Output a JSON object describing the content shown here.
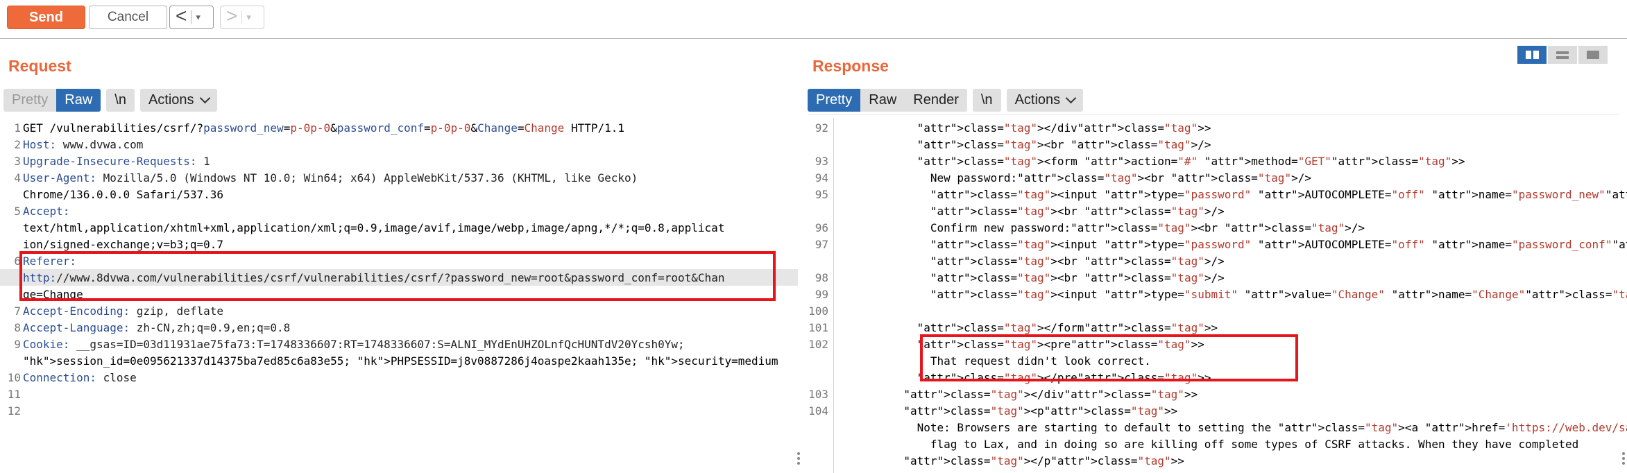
{
  "toolbar": {
    "send_label": "Send",
    "cancel_label": "Cancel",
    "back_arrow": "<",
    "forward_arrow": ">",
    "dropdown": "▾"
  },
  "request": {
    "title": "Request",
    "tabs": [
      "Pretty",
      "Raw",
      "\\n"
    ],
    "actions_label": "Actions",
    "lines": [
      {
        "n": "1",
        "text": "GET /vulnerabilities/csrf/?password_new=p-0p-0&password_conf=p-0p-0&Change=Change HTTP/1.1"
      },
      {
        "n": "2",
        "text": "Host: www.dvwa.com"
      },
      {
        "n": "3",
        "text": "Upgrade-Insecure-Requests: 1"
      },
      {
        "n": "4",
        "text": "User-Agent: Mozilla/5.0 (Windows NT 10.0; Win64; x64) AppleWebKit/537.36 (KHTML, like Gecko)"
      },
      {
        "n": "",
        "text": "Chrome/136.0.0.0 Safari/537.36"
      },
      {
        "n": "5",
        "text": "Accept:"
      },
      {
        "n": "",
        "text": "text/html,application/xhtml+xml,application/xml;q=0.9,image/avif,image/webp,image/apng,*/*;q=0.8,applicat"
      },
      {
        "n": "",
        "text": "ion/signed-exchange;v=b3;q=0.7"
      },
      {
        "n": "6",
        "text": "Referer:"
      },
      {
        "n": "",
        "text": "http://www.8dvwa.com/vulnerabilities/csrf/vulnerabilities/csrf/?password_new=root&password_conf=root&Chan"
      },
      {
        "n": "",
        "text": "ge=Change"
      },
      {
        "n": "7",
        "text": "Accept-Encoding: gzip, deflate"
      },
      {
        "n": "8",
        "text": "Accept-Language: zh-CN,zh;q=0.9,en;q=0.8"
      },
      {
        "n": "9",
        "text": "Cookie: __gsas=ID=03d11931ae75fa73:T=1748336607:RT=1748336607:S=ALNI_MYdEnUHZOLnfQcHUNTdV20Ycsh0Yw;"
      },
      {
        "n": "",
        "text": "session_id=0e095621337d14375ba7ed85c6a83e55; PHPSESSID=j8v0887286j4oaspe2kaah135e; security=medium"
      },
      {
        "n": "10",
        "text": "Connection: close"
      },
      {
        "n": "11",
        "text": ""
      },
      {
        "n": "12",
        "text": ""
      }
    ]
  },
  "response": {
    "title": "Response",
    "tabs": [
      "Pretty",
      "Raw",
      "Render",
      "\\n"
    ],
    "actions_label": "Actions",
    "lines": [
      {
        "n": "92",
        "text": "            </div>"
      },
      {
        "n": "",
        "text": "            <br />"
      },
      {
        "n": "93",
        "text": "            <form action=\"#\" method=\"GET\">"
      },
      {
        "n": "94",
        "text": "              New password:<br />"
      },
      {
        "n": "95",
        "text": "              <input type=\"password\" AUTOCOMPLETE=\"off\" name=\"password_new\">"
      },
      {
        "n": "",
        "text": "              <br />"
      },
      {
        "n": "96",
        "text": "              Confirm new password:<br />"
      },
      {
        "n": "97",
        "text": "              <input type=\"password\" AUTOCOMPLETE=\"off\" name=\"password_conf\">"
      },
      {
        "n": "",
        "text": "              <br />"
      },
      {
        "n": "98",
        "text": "              <br />"
      },
      {
        "n": "99",
        "text": "              <input type=\"submit\" value=\"Change\" name=\"Change\">"
      },
      {
        "n": "100",
        "text": ""
      },
      {
        "n": "101",
        "text": "            </form>"
      },
      {
        "n": "102",
        "text": "            <pre>"
      },
      {
        "n": "",
        "text": "              That request didn't look correct."
      },
      {
        "n": "",
        "text": "            </pre>"
      },
      {
        "n": "103",
        "text": "          </div>"
      },
      {
        "n": "104",
        "text": "          <p>"
      },
      {
        "n": "",
        "text": "            Note: Browsers are starting to default to setting the <a href='https://web.dev/samesite-cookies-exp"
      },
      {
        "n": "",
        "text": "              flag to Lax, and in doing so are killing off some types of CSRF attacks. When they have completed"
      },
      {
        "n": "",
        "text": "          </p>"
      }
    ]
  }
}
